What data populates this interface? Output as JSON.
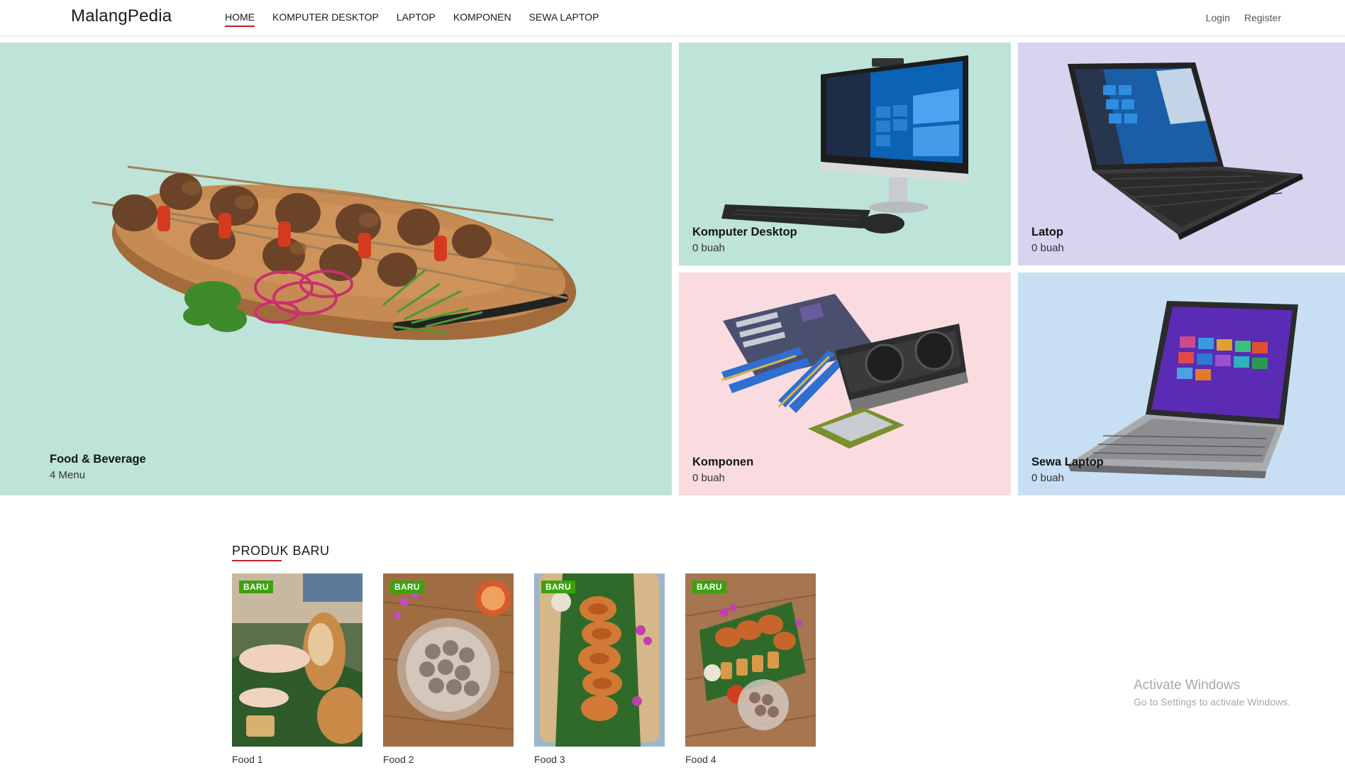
{
  "navbar": {
    "brand": "MalangPedia",
    "links": [
      {
        "label": "HOME",
        "active": true
      },
      {
        "label": "KOMPUTER DESKTOP",
        "active": false
      },
      {
        "label": "LAPTOP",
        "active": false
      },
      {
        "label": "KOMPONEN",
        "active": false
      },
      {
        "label": "SEWA LAPTOP",
        "active": false
      }
    ],
    "login": "Login",
    "register": "Register"
  },
  "categories": {
    "food": {
      "title": "Food & Beverage",
      "count": "4 Menu",
      "bg": "#bee3d9"
    },
    "desktop": {
      "title": "Komputer Desktop",
      "count": "0 buah",
      "bg": "#bee3d9"
    },
    "laptop": {
      "title": "Latop",
      "count": "0 buah",
      "bg": "#d6d4ee"
    },
    "komponen": {
      "title": "Komponen",
      "count": "0 buah",
      "bg": "#f9dbe0"
    },
    "sewa": {
      "title": "Sewa Laptop",
      "count": "0 buah",
      "bg": "#c8dff3"
    }
  },
  "new_products": {
    "title": "PRODUK BARU",
    "items": [
      {
        "name": "Food 1",
        "badge": "BARU"
      },
      {
        "name": "Food 2",
        "badge": "BARU"
      },
      {
        "name": "Food 3",
        "badge": "BARU"
      },
      {
        "name": "Food 4",
        "badge": "BARU"
      }
    ]
  },
  "watermark": {
    "line1": "Activate Windows",
    "line2": "Go to Settings to activate Windows."
  },
  "colors": {
    "accent": "#c0202a",
    "badge": "#3aa30c"
  }
}
